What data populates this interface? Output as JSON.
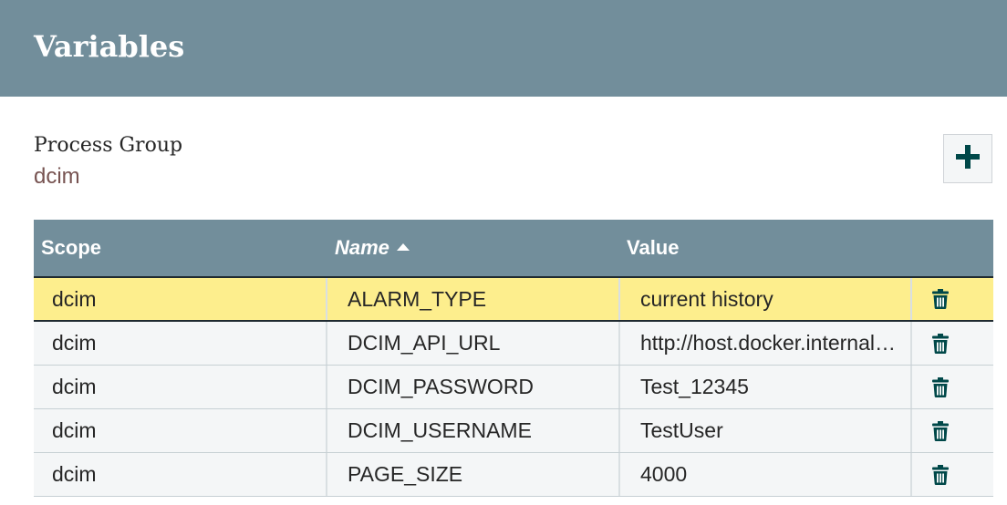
{
  "dialog": {
    "title": "Variables"
  },
  "process_group": {
    "label": "Process Group",
    "value": "dcim"
  },
  "icons": {
    "add": "plus-icon",
    "delete": "trash-icon",
    "sort": "sort-ascending-icon"
  },
  "colors": {
    "header_bg": "#728e9b",
    "selected_row": "#fdee8d",
    "icon_accent": "#004849",
    "process_group_value": "#775351"
  },
  "table": {
    "columns": {
      "scope": "Scope",
      "name": "Name",
      "value": "Value"
    },
    "sorted_by": "Name",
    "sort_direction": "ascending",
    "rows": [
      {
        "scope": "dcim",
        "name": "ALARM_TYPE",
        "value": "current history",
        "selected": true
      },
      {
        "scope": "dcim",
        "name": "DCIM_API_URL",
        "value": "http://host.docker.internal…",
        "selected": false
      },
      {
        "scope": "dcim",
        "name": "DCIM_PASSWORD",
        "value": "Test_12345",
        "selected": false
      },
      {
        "scope": "dcim",
        "name": "DCIM_USERNAME",
        "value": "TestUser",
        "selected": false
      },
      {
        "scope": "dcim",
        "name": "PAGE_SIZE",
        "value": "4000",
        "selected": false
      }
    ]
  }
}
